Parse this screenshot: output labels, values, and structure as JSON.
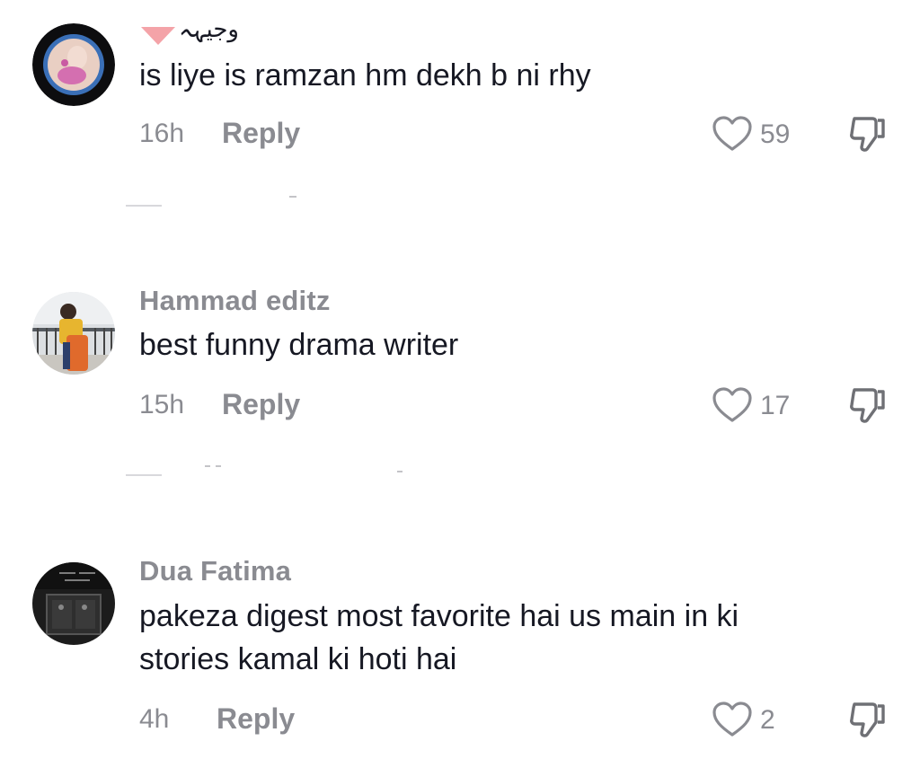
{
  "comments": [
    {
      "username": "وجیہہ",
      "text_lines": [
        "is liye is ramzan hm dekh b ni rhy"
      ],
      "time": "16h",
      "reply_label": "Reply",
      "likes": "59"
    },
    {
      "username": "Hammad editz",
      "text_lines": [
        "best funny drama writer"
      ],
      "time": "15h",
      "reply_label": "Reply",
      "likes": "17"
    },
    {
      "username": "Dua Fatima",
      "text_lines": [
        "pakeza digest most favorite hai us main in ki",
        "stories kamal ki hoti hai"
      ],
      "time": "4h",
      "reply_label": "Reply",
      "likes": "2"
    }
  ],
  "icons": {
    "like": "heart-outline-icon",
    "dislike": "thumbs-down-icon",
    "username_badge": "heart-icon"
  },
  "colors": {
    "text": "#161823",
    "muted": "#8a8b91",
    "badge": "#f4a3a8"
  }
}
